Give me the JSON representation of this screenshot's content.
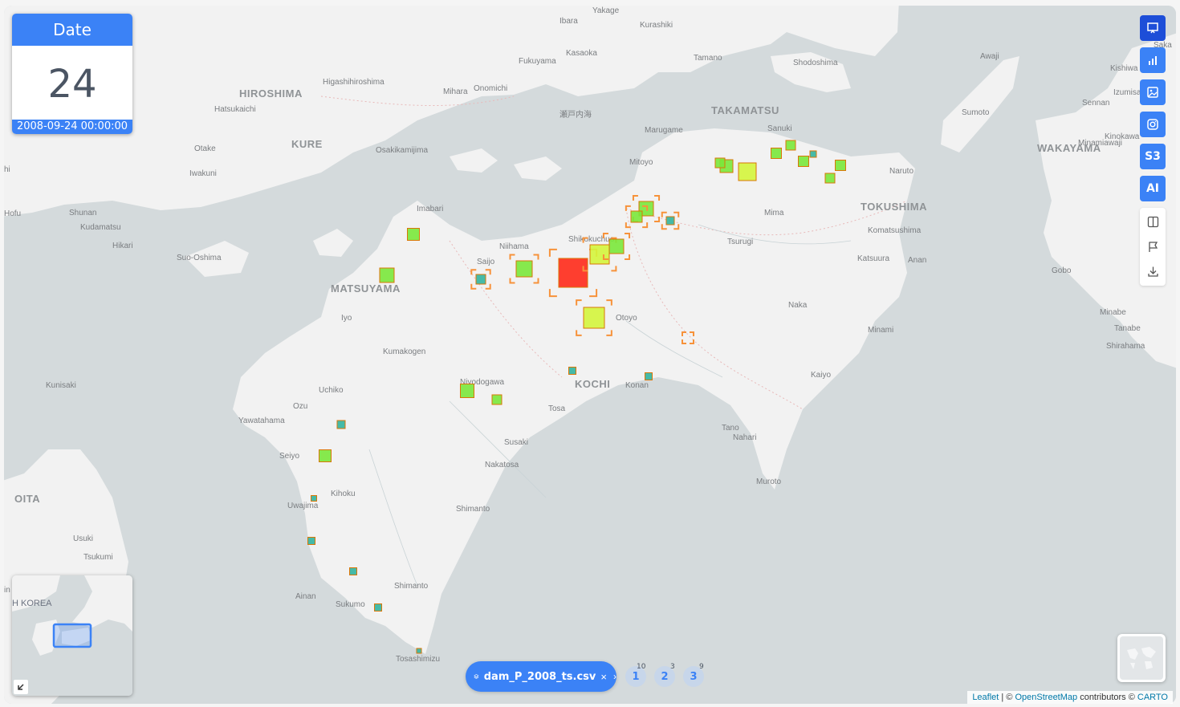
{
  "date_widget": {
    "header": "Date",
    "day": "24",
    "timestamp": "2008-09-24 00:00:00"
  },
  "toolbar": {
    "buttons": [
      {
        "name": "presentation-icon",
        "label": ""
      },
      {
        "name": "bar-chart-icon",
        "label": ""
      },
      {
        "name": "image-icon",
        "label": ""
      },
      {
        "name": "instagram-icon",
        "label": ""
      },
      {
        "name": "s3-button",
        "label": "S3"
      },
      {
        "name": "ai-button",
        "label": "AI"
      }
    ],
    "white_buttons": [
      "split-view-icon",
      "flag-icon",
      "download-icon"
    ]
  },
  "dataset": {
    "name": "dam_P_2008_ts.csv",
    "close": "×",
    "chevron": "›",
    "pages": [
      {
        "label": "1",
        "count": "10"
      },
      {
        "label": "2",
        "count": "3"
      },
      {
        "label": "3",
        "count": "9"
      }
    ]
  },
  "attribution": {
    "leaflet": "Leaflet",
    "sep": " | © ",
    "osm": "OpenStreetMap",
    "contributors": " contributors © ",
    "carto": "CARTO"
  },
  "minimap": {
    "label": "H KOREA",
    "toggle_icon": "arrow-down-left-icon"
  },
  "colors": {
    "accent": "#3b82f6",
    "water": "#d4dadc",
    "land": "#f2f2f2",
    "marker_high": "#ff2a1a",
    "marker_mid": "#d4f53c",
    "marker_low": "#7ae83b",
    "marker_tiny": "#32b4a0",
    "selection": "#f7923a"
  },
  "map_labels": [
    {
      "text": "Yakage",
      "cls": ""
    },
    {
      "text": "Ibara",
      "cls": ""
    },
    {
      "text": "Kurashiki",
      "cls": ""
    },
    {
      "text": "Kasaoka",
      "cls": ""
    },
    {
      "text": "Fukuyama",
      "cls": ""
    },
    {
      "text": "Tamano",
      "cls": ""
    },
    {
      "text": "Shodoshima",
      "cls": ""
    },
    {
      "text": "Awaji",
      "cls": ""
    },
    {
      "text": "Saka",
      "cls": ""
    },
    {
      "text": "Kishiwa",
      "cls": ""
    },
    {
      "text": "HIROSHIMA",
      "cls": "big"
    },
    {
      "text": "Higashihiroshima",
      "cls": ""
    },
    {
      "text": "Mihara",
      "cls": ""
    },
    {
      "text": "Onomichi",
      "cls": ""
    },
    {
      "text": "Hatsukaichi",
      "cls": ""
    },
    {
      "text": "瀬戸内海",
      "cls": ""
    },
    {
      "text": "TAKAMATSU",
      "cls": "big"
    },
    {
      "text": "Izumisano",
      "cls": ""
    },
    {
      "text": "Sennan",
      "cls": ""
    },
    {
      "text": "Sumoto",
      "cls": ""
    },
    {
      "text": "Marugame",
      "cls": ""
    },
    {
      "text": "Sanuki",
      "cls": ""
    },
    {
      "text": "KURE",
      "cls": "big"
    },
    {
      "text": "Otake",
      "cls": ""
    },
    {
      "text": "Osakikamijima",
      "cls": ""
    },
    {
      "text": "Kinokawa",
      "cls": ""
    },
    {
      "text": "Minamiawaji",
      "cls": ""
    },
    {
      "text": "WAKAYAMA",
      "cls": "big"
    },
    {
      "text": "Mitoyo",
      "cls": ""
    },
    {
      "text": "Iwakuni",
      "cls": ""
    },
    {
      "text": "Naruto",
      "cls": ""
    },
    {
      "text": "Imabari",
      "cls": ""
    },
    {
      "text": "TOKUSHIMA",
      "cls": "big"
    },
    {
      "text": "Mima",
      "cls": ""
    },
    {
      "text": "Hofu",
      "cls": ""
    },
    {
      "text": "Shunan",
      "cls": ""
    },
    {
      "text": "Kudamatsu",
      "cls": ""
    },
    {
      "text": "Komatsushima",
      "cls": ""
    },
    {
      "text": "Shikokuchuo",
      "cls": ""
    },
    {
      "text": "Tsurugi",
      "cls": ""
    },
    {
      "text": "Hikari",
      "cls": ""
    },
    {
      "text": "Niihama",
      "cls": ""
    },
    {
      "text": "Suo-Oshima",
      "cls": ""
    },
    {
      "text": "Saijo",
      "cls": ""
    },
    {
      "text": "Katsuura",
      "cls": ""
    },
    {
      "text": "Anan",
      "cls": ""
    },
    {
      "text": "Gobo",
      "cls": ""
    },
    {
      "text": "MATSUYAMA",
      "cls": "big"
    },
    {
      "text": "Naka",
      "cls": ""
    },
    {
      "text": "Minabe",
      "cls": ""
    },
    {
      "text": "Iyo",
      "cls": ""
    },
    {
      "text": "Otoyo",
      "cls": ""
    },
    {
      "text": "Tanabe",
      "cls": ""
    },
    {
      "text": "Minami",
      "cls": ""
    },
    {
      "text": "Shirahama",
      "cls": ""
    },
    {
      "text": "Kumakogen",
      "cls": ""
    },
    {
      "text": "Nivodogawa",
      "cls": ""
    },
    {
      "text": "Kaiyo",
      "cls": ""
    },
    {
      "text": "KOCHI",
      "cls": "big"
    },
    {
      "text": "Konan",
      "cls": ""
    },
    {
      "text": "Kunisaki",
      "cls": ""
    },
    {
      "text": "Uchiko",
      "cls": ""
    },
    {
      "text": "Ozu",
      "cls": ""
    },
    {
      "text": "Tosa",
      "cls": ""
    },
    {
      "text": "Yawatahama",
      "cls": ""
    },
    {
      "text": "Tano",
      "cls": ""
    },
    {
      "text": "Nahari",
      "cls": ""
    },
    {
      "text": "Susaki",
      "cls": ""
    },
    {
      "text": "Seiyo",
      "cls": ""
    },
    {
      "text": "Nakatosa",
      "cls": ""
    },
    {
      "text": "Muroto",
      "cls": ""
    },
    {
      "text": "OITA",
      "cls": "big"
    },
    {
      "text": "Kihoku",
      "cls": ""
    },
    {
      "text": "Uwajima",
      "cls": ""
    },
    {
      "text": "Shimanto",
      "cls": ""
    },
    {
      "text": "Usuki",
      "cls": ""
    },
    {
      "text": "Tsukumi",
      "cls": ""
    },
    {
      "text": "Shimanto",
      "cls": ""
    },
    {
      "text": "Ainan",
      "cls": ""
    },
    {
      "text": "Sukumo",
      "cls": ""
    },
    {
      "text": "Tosashimizu",
      "cls": ""
    },
    {
      "text": "hi",
      "cls": ""
    },
    {
      "text": "in",
      "cls": ""
    }
  ]
}
